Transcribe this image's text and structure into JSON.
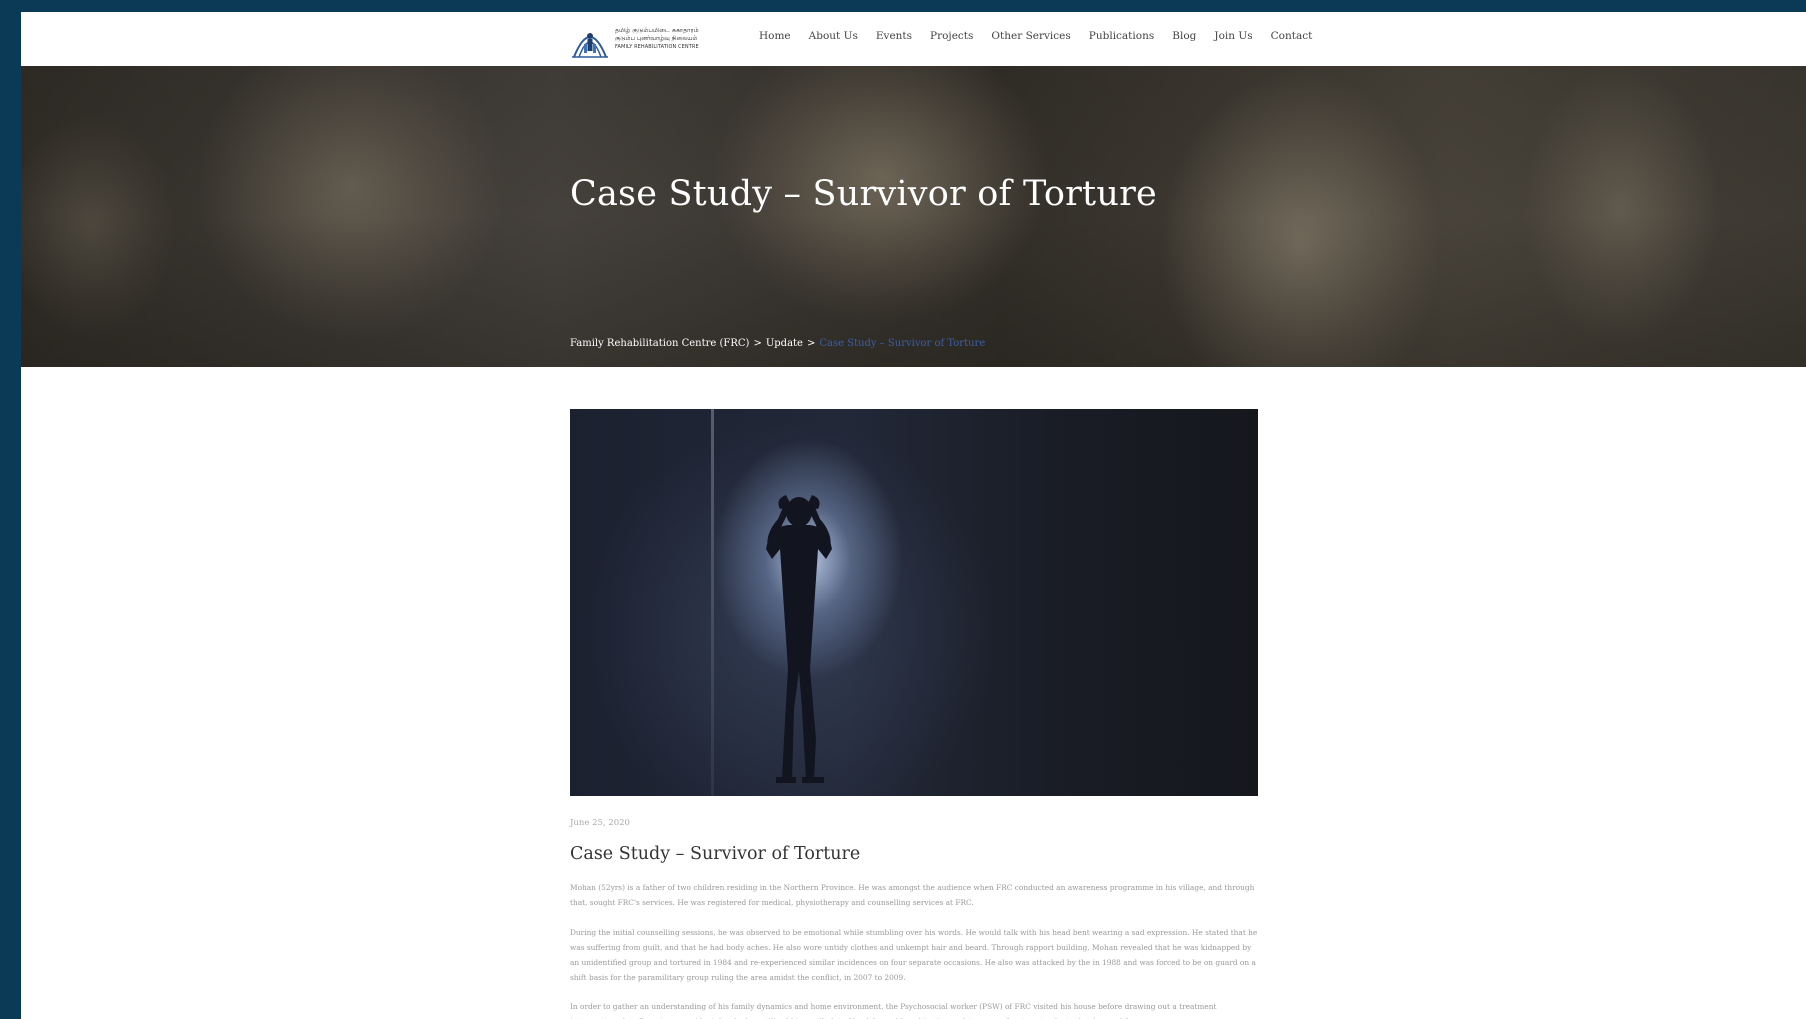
{
  "header": {
    "logo": {
      "tamil_line1": "தமிழ் குடும்பமிடை சுகாதாரம்",
      "tamil_line2": "குடும்ப புனர்வாழ்வு நிலையம்",
      "english": "FAMILY REHABILITATION CENTRE"
    },
    "nav": [
      {
        "label": "Home"
      },
      {
        "label": "About Us"
      },
      {
        "label": "Events"
      },
      {
        "label": "Projects"
      },
      {
        "label": "Other Services"
      },
      {
        "label": "Publications"
      },
      {
        "label": "Blog"
      },
      {
        "label": "Join Us"
      },
      {
        "label": "Contact"
      }
    ]
  },
  "hero": {
    "title": "Case Study – Survivor of Torture",
    "breadcrumb": {
      "home": "Family Rehabilitation Centre (FRC)",
      "separator": ">",
      "parent": "Update",
      "current": "Case Study – Survivor of Torture"
    }
  },
  "post": {
    "date": "June 25, 2020",
    "title": "Case Study – Survivor of Torture",
    "paragraphs": [
      "Mohan (52yrs) is a father of two children residing in the Northern Province. He was amongst the audience when FRC conducted an awareness programme in his village, and through that, sought FRC's services. He was registered for medical, physiotherapy and counselling services at FRC.",
      "During the initial counselling sessions, he was observed to be emotional while stumbling over his words. He would talk with his head bent wearing a sad expression. He stated that he was suffering from guilt, and that he had body aches. He also wore untidy clothes and unkempt hair and beard. Through rapport building, Mohan revealed that he was kidnapped by an unidentified group and tortured in 1984 and re-experienced similar incidences on four separate occasions. He also was attacked by the in 1988 and was forced to be on guard on a shift basis for the paramilitary group ruling the area amidst the conflict, in 2007 to 2009.",
      "In order to gather an understanding of his family dynamics and home environment, the Psychosocial worker (PSW) of FRC visited his house before drawing out a treatment intervention plan. Poverty was evident, but he has utilized his small plot of land for paddy cultivation and to grow a few tomato plants that he used for"
    ]
  },
  "colors": {
    "outer_background": "#0b3a57",
    "breadcrumb_current": "#3a5fa8",
    "body_text": "#9a9a9a"
  }
}
